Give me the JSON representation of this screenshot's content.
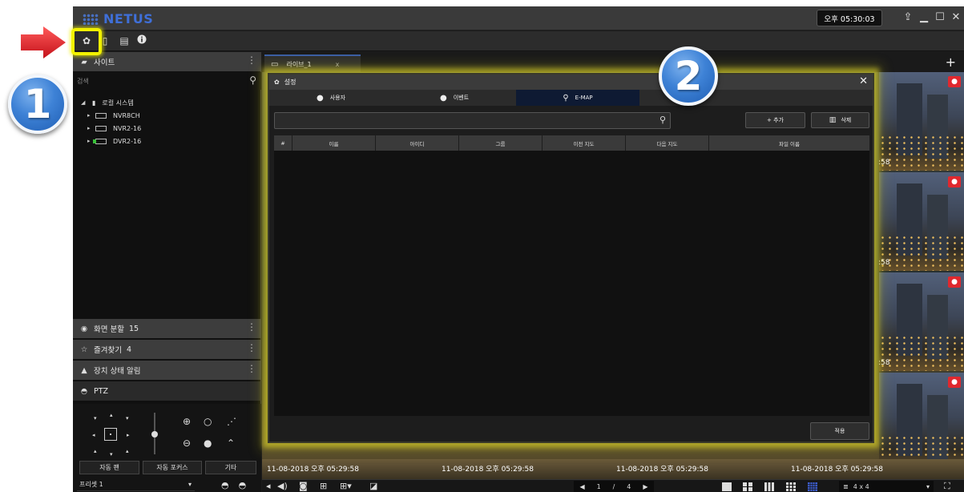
{
  "app": {
    "logo_text": "NETUS",
    "clock": "오후 05:30:03",
    "brand_color": "#3f6fd8"
  },
  "sidebar": {
    "site_header": "사이트",
    "search_placeholder": "검색",
    "tree_root": "로컬 시스템",
    "devices": [
      {
        "label": "NVR8CH"
      },
      {
        "label": "NVR2-16"
      },
      {
        "label": "DVR2-16"
      }
    ],
    "screen_split": {
      "label": "화면 분할",
      "count": "15"
    },
    "favorites": {
      "label": "즐겨찾기",
      "count": "4"
    },
    "device_alarm": {
      "label": "장치 상태 알림"
    },
    "ptz": {
      "label": "PTZ",
      "auto_pan": "자동 팬",
      "auto_focus": "자동 포커스",
      "other": "기타",
      "preset_value": "프리셋 1"
    }
  },
  "main": {
    "live_tab": "라이브_1",
    "live_tab_close": "x",
    "timestamps": [
      "11-08-2018 오후 05:29:58",
      "11-08-2018 오후 05:29:58",
      "11-08-2018 오후 05:29:58",
      "11-08-2018 오후 05:29:58"
    ],
    "thumb_time": ":58",
    "pager": {
      "current": "1",
      "sep": "/",
      "total": "4"
    },
    "layout_value": "4 x 4"
  },
  "dialog": {
    "title": "설정",
    "close": "✕",
    "tabs": [
      {
        "label": "사용자",
        "icon": "user-icon"
      },
      {
        "label": "이벤트",
        "icon": "event-user-icon"
      },
      {
        "label": "E-MAP",
        "icon": "map-pin-icon",
        "active": true
      }
    ],
    "add_button": "+ 추가",
    "delete_button": "삭제",
    "columns": [
      "#",
      "이름",
      "아이디",
      "그룹",
      "이전 지도",
      "다음 지도",
      "파일 이름"
    ],
    "apply_button": "적용"
  },
  "annotations": {
    "step1": "1",
    "step2": "2",
    "highlight_color": "#f2f200",
    "arrow_color": "#e8202a"
  }
}
